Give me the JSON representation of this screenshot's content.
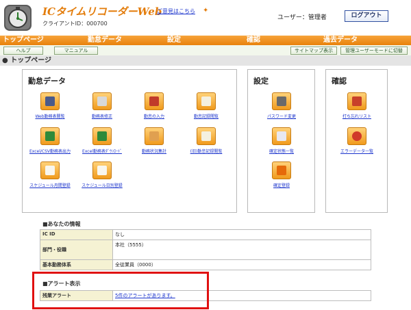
{
  "header": {
    "app_title": "ICタイムリコーダーWeb",
    "feedback_link": "ご意見はこちら",
    "client_id": "クライアントID：000700",
    "user_label": "ユーザー：管理者",
    "logout": "ログアウト"
  },
  "nav": [
    "トップページ",
    "勤怠データ",
    "設定",
    "確認",
    "過去データ"
  ],
  "subbar": {
    "help": "ヘルプ",
    "manual": "マニュアル",
    "sitemap": "サイトマップ表示",
    "admin_mode": "管理ユーザーモードに切替"
  },
  "page_heading": "● トップページ",
  "panels": {
    "attendance": {
      "title": "勤怠データ",
      "items": [
        "Web勤務表閲覧",
        "勤務表修正",
        "勤怠の入力",
        "勤怠記録閲覧",
        "Excel/CSV勤務表出力",
        "Excel勤務表ﾀﾞｳﾝﾛｰﾄﾞ",
        "勤務状況集計",
        "(旧)勤怠記録閲覧",
        "スケジュール月間登録",
        "スケジュール日別登録"
      ]
    },
    "settings": {
      "title": "設定",
      "items": [
        "パスワード変更",
        "確定状態一覧",
        "確定登録"
      ]
    },
    "confirm": {
      "title": "確認",
      "items": [
        "打ち忘れリスト",
        "エラーデータ一覧"
      ]
    }
  },
  "your_info": {
    "title": "■あなたの情報",
    "rows": [
      {
        "key": "IC ID",
        "value": "なし"
      },
      {
        "key": "部門・役職",
        "value": "本社（5555）"
      },
      {
        "key": "基本勤務体系",
        "value": "全従業員（0000）"
      }
    ]
  },
  "alert": {
    "title": "■アラート表示",
    "key": "残業アラート",
    "value": "5件のアラートがあります。"
  },
  "colors": {
    "accent": "#e8820c",
    "highlight": "#e01010",
    "link": "#1a33cc"
  }
}
